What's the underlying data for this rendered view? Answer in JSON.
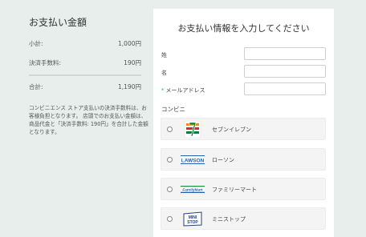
{
  "summary": {
    "title": "お支払い金額",
    "subtotal_label": "小計:",
    "subtotal_value": "1,000円",
    "fee_label": "決済手数料:",
    "fee_value": "190円",
    "total_label": "合計:",
    "total_value": "1,190円",
    "note": "コンビニエンス ストア支払いの決済手数料は、お客様負担となります。 店頭でのお支払い金額は、商品代金と「決済手数料: 190円」を合計した金額となります。"
  },
  "form": {
    "title": "お支払い情報を入力してください",
    "last_name_label": "姓",
    "first_name_label": "名",
    "email_required_mark": "*",
    "email_label": "メールアドレス",
    "last_name_value": "",
    "first_name_value": "",
    "email_value": ""
  },
  "store_section": {
    "label": "コンビニ",
    "options": [
      {
        "label": "セブンイレブン",
        "icon": "seven-eleven-logo"
      },
      {
        "label": "ローソン",
        "icon": "lawson-logo",
        "logo_text": "LAWSON"
      },
      {
        "label": "ファミリーマート",
        "icon": "familymart-logo",
        "logo_text": "FamilyMart"
      },
      {
        "label": "ミニストップ",
        "icon": "ministop-logo",
        "logo_text": "MINI STOP"
      }
    ]
  },
  "colors": {
    "background": "#e8eeec",
    "panel": "#ffffff",
    "required_mark": "#2bb39b",
    "lawson_blue": "#1f5fae",
    "familymart_green": "#1f8f4e",
    "seven_orange": "#f08a24",
    "seven_red": "#d7282f",
    "seven_green": "#0e7a3e"
  }
}
